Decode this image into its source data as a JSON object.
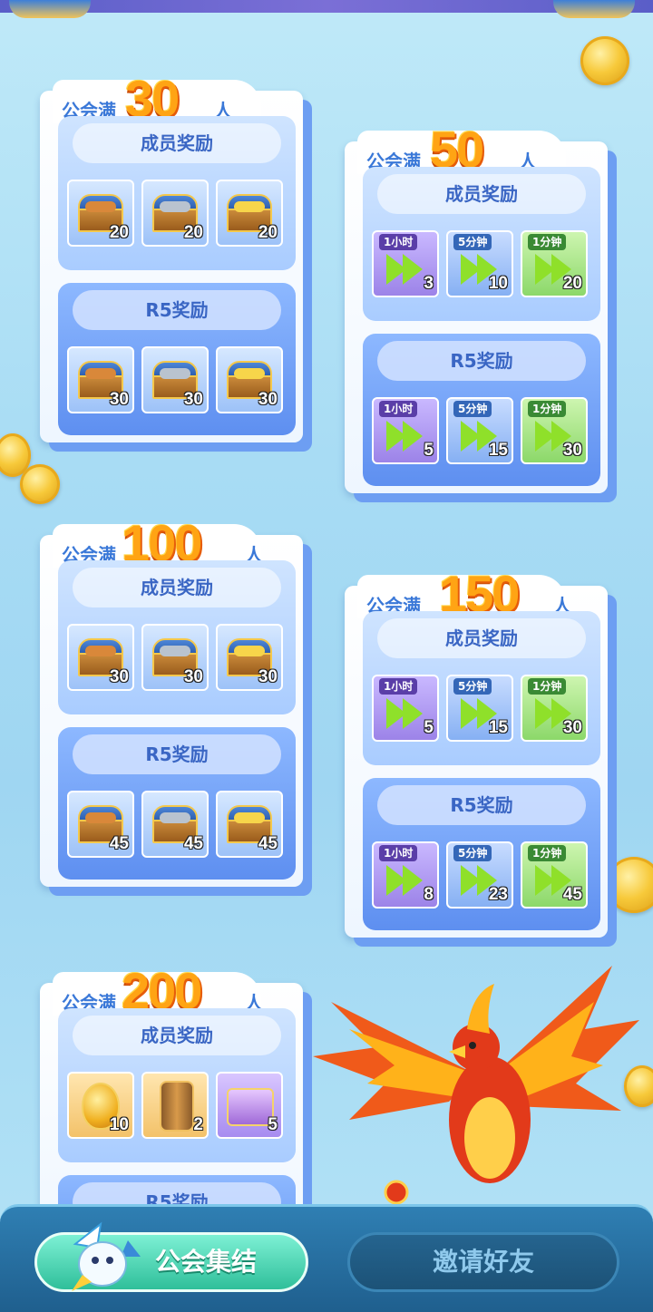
{
  "header_prefix": "公会满",
  "header_suffix": "人",
  "section_member": "成员奖励",
  "section_r5": "R5奖励",
  "tiers": [
    {
      "num": "30",
      "member": [
        {
          "icon": "wood-chest-icon",
          "count": "20"
        },
        {
          "icon": "iron-chest-icon",
          "count": "20"
        },
        {
          "icon": "gold-chest-icon",
          "count": "20"
        }
      ],
      "r5": [
        {
          "icon": "wood-chest-icon",
          "count": "30"
        },
        {
          "icon": "iron-chest-icon",
          "count": "30"
        },
        {
          "icon": "gold-chest-icon",
          "count": "30"
        }
      ]
    },
    {
      "num": "50",
      "member": [
        {
          "icon": "speedup-icon",
          "tag": "1小时",
          "count": "3"
        },
        {
          "icon": "speedup-icon",
          "tag": "5分钟",
          "count": "10"
        },
        {
          "icon": "speedup-icon",
          "tag": "1分钟",
          "count": "20"
        }
      ],
      "r5": [
        {
          "icon": "speedup-icon",
          "tag": "1小时",
          "count": "5"
        },
        {
          "icon": "speedup-icon",
          "tag": "5分钟",
          "count": "15"
        },
        {
          "icon": "speedup-icon",
          "tag": "1分钟",
          "count": "30"
        }
      ]
    },
    {
      "num": "100",
      "member": [
        {
          "icon": "wood-chest-icon",
          "count": "30"
        },
        {
          "icon": "iron-chest-icon",
          "count": "30"
        },
        {
          "icon": "gold-chest-icon",
          "count": "30"
        }
      ],
      "r5": [
        {
          "icon": "wood-chest-icon",
          "count": "45"
        },
        {
          "icon": "iron-chest-icon",
          "count": "45"
        },
        {
          "icon": "gold-chest-icon",
          "count": "45"
        }
      ]
    },
    {
      "num": "150",
      "member": [
        {
          "icon": "speedup-icon",
          "tag": "1小时",
          "count": "5"
        },
        {
          "icon": "speedup-icon",
          "tag": "5分钟",
          "count": "15"
        },
        {
          "icon": "speedup-icon",
          "tag": "1分钟",
          "count": "30"
        }
      ],
      "r5": [
        {
          "icon": "speedup-icon",
          "tag": "1小时",
          "count": "8"
        },
        {
          "icon": "speedup-icon",
          "tag": "5分钟",
          "count": "23"
        },
        {
          "icon": "speedup-icon",
          "tag": "1分钟",
          "count": "45"
        }
      ]
    },
    {
      "num": "200",
      "member": [
        {
          "icon": "golden-egg-icon",
          "count": "10"
        },
        {
          "icon": "barrel-icon",
          "count": "2"
        },
        {
          "icon": "purple-chest-icon",
          "count": "5"
        }
      ]
    }
  ],
  "buttons": {
    "rally": "公会集结",
    "invite": "邀请好友"
  },
  "colors": {
    "accent_blue": "#3a78d8",
    "number_orange": "#ffa414",
    "rally_green": "#2fbf9a",
    "bottom_bar": "#1f5f8e"
  }
}
